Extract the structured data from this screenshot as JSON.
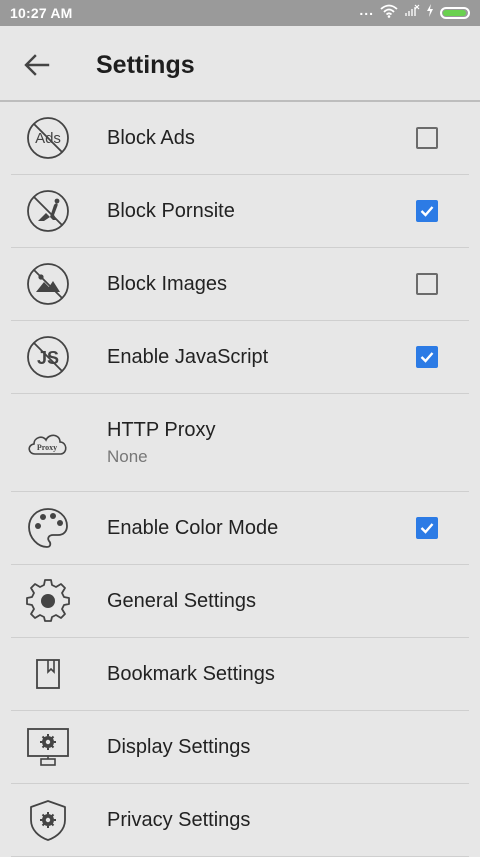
{
  "status_bar": {
    "time": "10:27 AM",
    "dots": "...",
    "battery_level": 0.95
  },
  "app_bar": {
    "title": "Settings"
  },
  "icon_texts": {
    "ads": "Ads",
    "js": "JS",
    "proxy": "Proxy"
  },
  "settings": [
    {
      "label": "Block Ads",
      "checked": false
    },
    {
      "label": "Block Pornsite",
      "checked": true
    },
    {
      "label": "Block Images",
      "checked": false
    },
    {
      "label": "Enable JavaScript",
      "checked": true
    },
    {
      "label": "HTTP Proxy",
      "subtitle": "None"
    },
    {
      "label": "Enable Color Mode",
      "checked": true
    },
    {
      "label": "General Settings"
    },
    {
      "label": "Bookmark Settings"
    },
    {
      "label": "Display Settings"
    },
    {
      "label": "Privacy Settings"
    }
  ],
  "colors": {
    "accent": "#2c7be5",
    "status_bar": "#9a9a9a",
    "background": "#e7e7e7",
    "battery": "#6ad14f"
  }
}
